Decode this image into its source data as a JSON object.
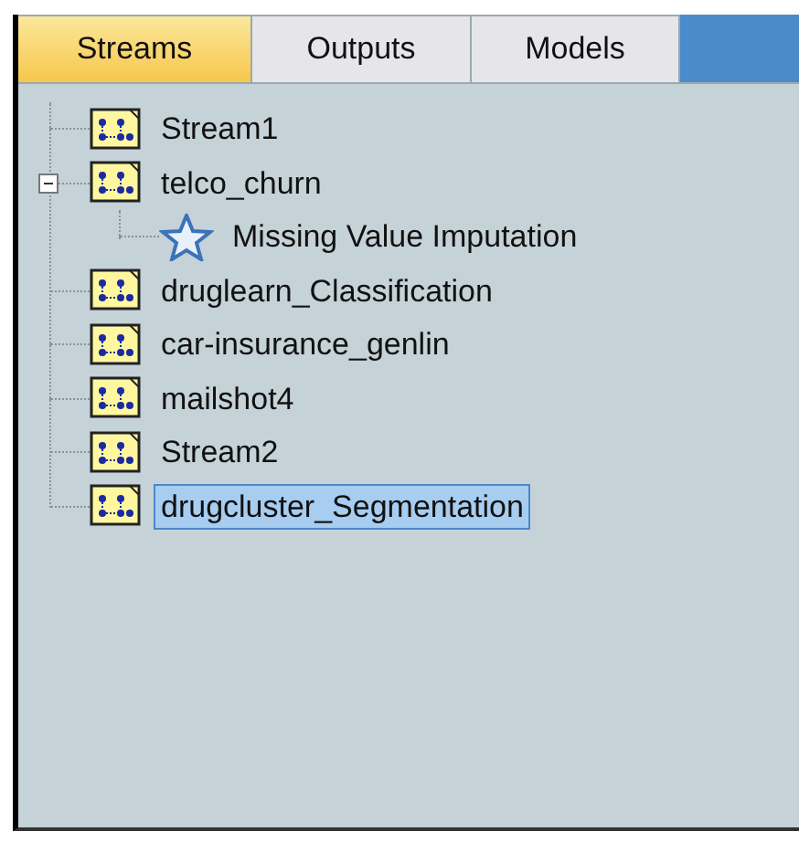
{
  "tabs": [
    {
      "label": "Streams",
      "selected": true
    },
    {
      "label": "Outputs",
      "selected": false
    },
    {
      "label": "Models",
      "selected": false
    }
  ],
  "tree": [
    {
      "label": "Stream1",
      "kind": "stream",
      "selected": false
    },
    {
      "label": "telco_churn",
      "kind": "stream",
      "selected": false,
      "expanded": true,
      "children": [
        {
          "label": "Missing Value Imputation",
          "kind": "star",
          "selected": false
        }
      ]
    },
    {
      "label": "druglearn_Classification",
      "kind": "stream",
      "selected": false
    },
    {
      "label": "car-insurance_genlin",
      "kind": "stream",
      "selected": false
    },
    {
      "label": "mailshot4",
      "kind": "stream",
      "selected": false
    },
    {
      "label": "Stream2",
      "kind": "stream",
      "selected": false
    },
    {
      "label": "drugcluster_Segmentation",
      "kind": "stream",
      "selected": true
    }
  ]
}
